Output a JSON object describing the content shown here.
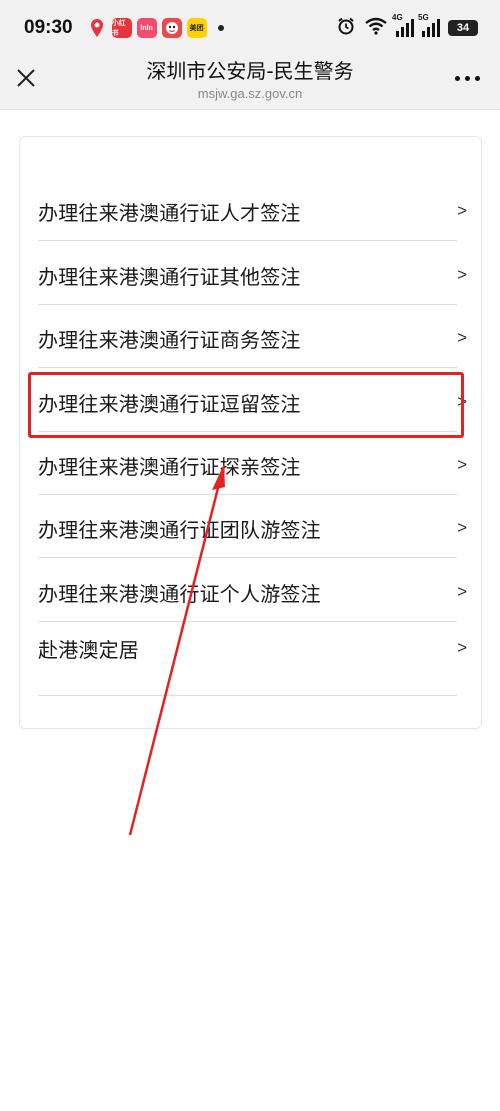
{
  "status_bar": {
    "time": "09:30",
    "notif_icons": [
      {
        "name": "map-pin-icon",
        "text": ""
      },
      {
        "name": "xiaohongshu-icon",
        "text": "小红书"
      },
      {
        "name": "pinduoduo-icon",
        "text": "lnln"
      },
      {
        "name": "cartoon-app-icon",
        "text": ""
      },
      {
        "name": "meituan-icon",
        "text": "美团"
      }
    ],
    "signal_1_label": "4G",
    "signal_2_label": "5G",
    "battery": "34"
  },
  "header": {
    "title": "深圳市公安局-民生警务",
    "url": "msjw.ga.sz.gov.cn"
  },
  "menu": {
    "items": [
      {
        "label": "办理往来港澳通行证人才签注",
        "chevron": ">"
      },
      {
        "label": "办理往来港澳通行证其他签注",
        "chevron": ">"
      },
      {
        "label": "办理往来港澳通行证商务签注",
        "chevron": ">"
      },
      {
        "label": "办理往来港澳通行证逗留签注",
        "chevron": ">"
      },
      {
        "label": "办理往来港澳通行证探亲签注",
        "chevron": ">"
      },
      {
        "label": "办理往来港澳通行证团队游签注",
        "chevron": ">"
      },
      {
        "label": "办理往来港澳通行证个人游签注",
        "chevron": ">"
      },
      {
        "label": "赴港澳定居",
        "chevron": ">"
      }
    ]
  },
  "annotation": {
    "highlight_color": "#e32222",
    "arrow_color": "#e32222"
  }
}
